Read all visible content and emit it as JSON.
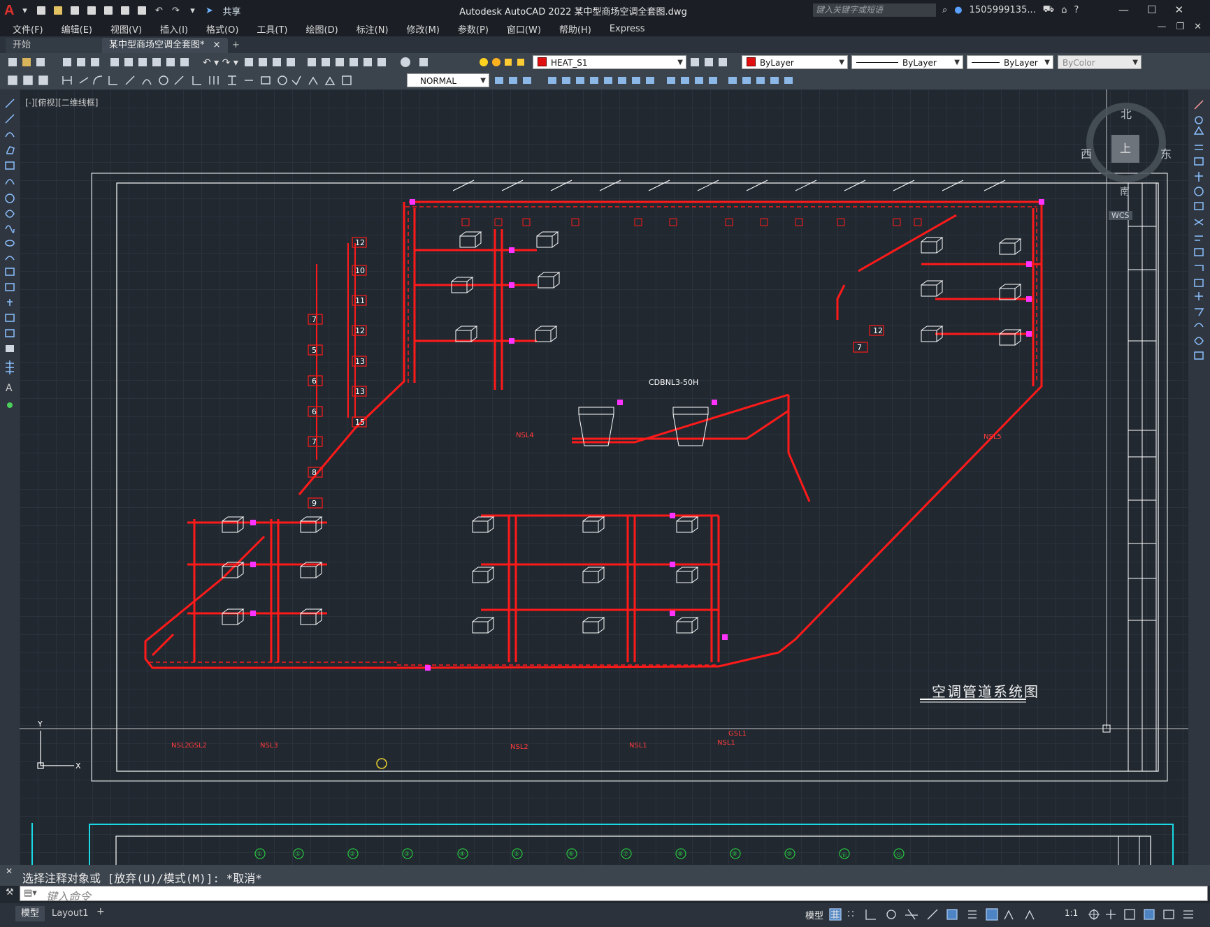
{
  "app": {
    "title": "Autodesk AutoCAD 2022    某中型商场空调全套图.dwg",
    "share_label": "共享",
    "search_placeholder": "键入关键字或短语",
    "user": "1505999135..."
  },
  "menu": [
    "文件(F)",
    "编辑(E)",
    "视图(V)",
    "插入(I)",
    "格式(O)",
    "工具(T)",
    "绘图(D)",
    "标注(N)",
    "修改(M)",
    "参数(P)",
    "窗口(W)",
    "帮助(H)",
    "Express"
  ],
  "tabs": {
    "start": "开始",
    "document": "某中型商场空调全套图*",
    "close": "×",
    "add": "+"
  },
  "toolbar": {
    "layer_name": "HEAT_S1",
    "color": "ByLayer",
    "linetype": "ByLayer",
    "lineweight": "ByLayer",
    "plotstyle": "ByColor",
    "dimstyle": "NORMAL"
  },
  "viewport": {
    "label": "[-][俯视][二维线框]",
    "viewcube": {
      "north": "北",
      "south": "南",
      "east": "东",
      "west": "西",
      "face": "上"
    },
    "wcs": "WCS"
  },
  "drawing": {
    "sheet_title": "空调管道系统图",
    "unit_label": "CDBNL3-50H",
    "riser_labels": [
      "12",
      "10",
      "11",
      "12",
      "13",
      "13",
      "15"
    ],
    "riser_labels_left": [
      "7",
      "5",
      "6",
      "6",
      "7",
      "8",
      "9"
    ],
    "riser_labels_right": [
      "12",
      "7"
    ],
    "bottom_labels": [
      "NSL2",
      "GSL2",
      "NSL3",
      "NSL2",
      "NSL1",
      "NSL1",
      "GSL1"
    ],
    "upper_labels": [
      "NSL4",
      "NSL5"
    ],
    "axis_bubbles": [
      "①",
      "①",
      "②",
      "③",
      "④",
      "⑤",
      "⑥",
      "⑦",
      "⑧",
      "⑨",
      "⑩",
      "⑪",
      "⑫"
    ]
  },
  "colors": {
    "pipe": "#ff1a1a",
    "valve": "#ff33ff",
    "frame": "#ffffff",
    "cyan": "#19d9e6",
    "bubble": "#28c840"
  },
  "command": {
    "history": "选择注释对象或 [放弃(U)/模式(M)]: *取消*",
    "placeholder": "键入命令"
  },
  "status": {
    "model_tab": "模型",
    "layout_tab": "Layout1",
    "add_layout": "+",
    "model_space": "模型",
    "scale": "1:1"
  }
}
